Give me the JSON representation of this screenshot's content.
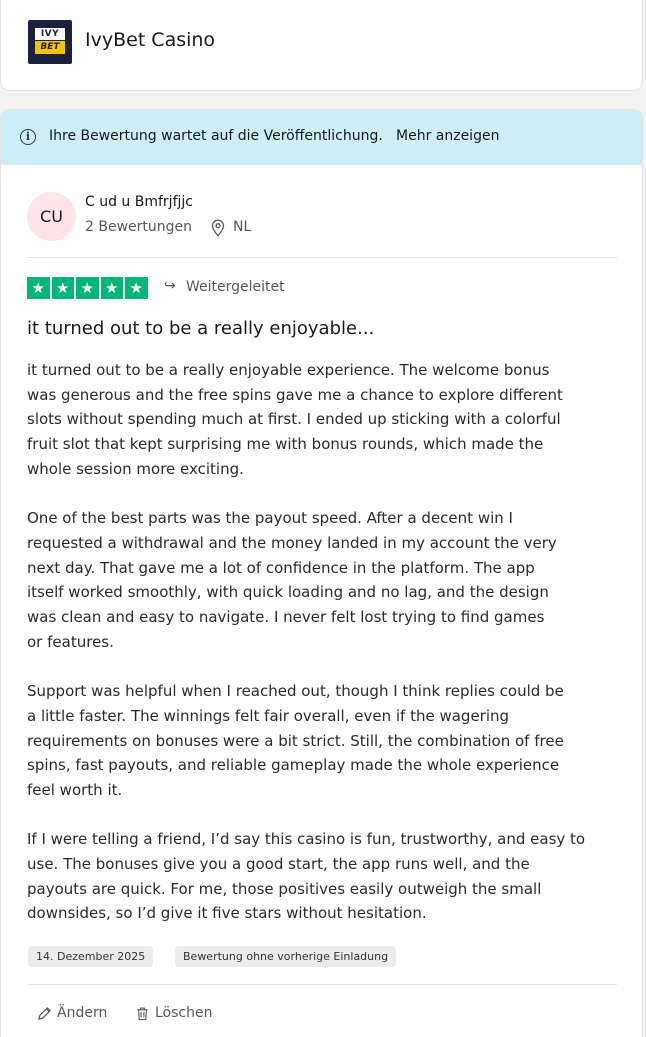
{
  "header": {
    "logo_top": "IVY",
    "logo_bottom": "BET",
    "company_name": "IvyBet Casino"
  },
  "banner": {
    "icon": "info-icon",
    "message": "Ihre Bewertung wartet auf die Veröffentlichung.",
    "link": "Mehr anzeigen"
  },
  "reviewer": {
    "initials": "CU",
    "name": "C ud u Bmfrjfjjc",
    "review_count": "2 Bewertungen",
    "country": "NL",
    "avatar_color": "#fde4e8"
  },
  "review": {
    "stars": 5,
    "star_symbol": "★",
    "star_color": "#00b67a",
    "redirect_icon": "↪",
    "redirect_label": "Weitergeleitet",
    "title": "it turned out to be a really enjoyable...",
    "paragraphs": [
      "it turned out to be a really enjoyable experience. The welcome bonus\nwas generous and the free spins gave me a chance to explore different\nslots without spending much at first. I ended up sticking with a colorful\nfruit slot that kept surprising me with bonus rounds, which made the\nwhole session more exciting.",
      "One of the best parts was the payout speed. After a decent win I\nrequested a withdrawal and the money landed in my account the very\nnext day. That gave me a lot of confidence in the platform. The app\nitself worked smoothly, with quick loading and no lag, and the design\nwas clean and easy to navigate. I never felt lost trying to find games\nor features.",
      "Support was helpful when I reached out, though I think replies could be\na little faster. The winnings felt fair overall, even if the wagering\nrequirements on bonuses were a bit strict. Still, the combination of free\nspins, fast payouts, and reliable gameplay made the whole experience\nfeel worth it.",
      "If I were telling a friend, I’d say this casino is fun, trustworthy, and easy to\nuse. The bonuses give you a good start, the app runs well, and the\npayouts are quick. For me, those positives easily outweigh the small\ndownsides, so I’d give it five stars without hesitation."
    ],
    "date": "14. Dezember 2025",
    "invitation_tag": "Bewertung ohne vorherige Einladung"
  },
  "actions": {
    "edit_label": "Ändern",
    "delete_label": "Löschen"
  }
}
